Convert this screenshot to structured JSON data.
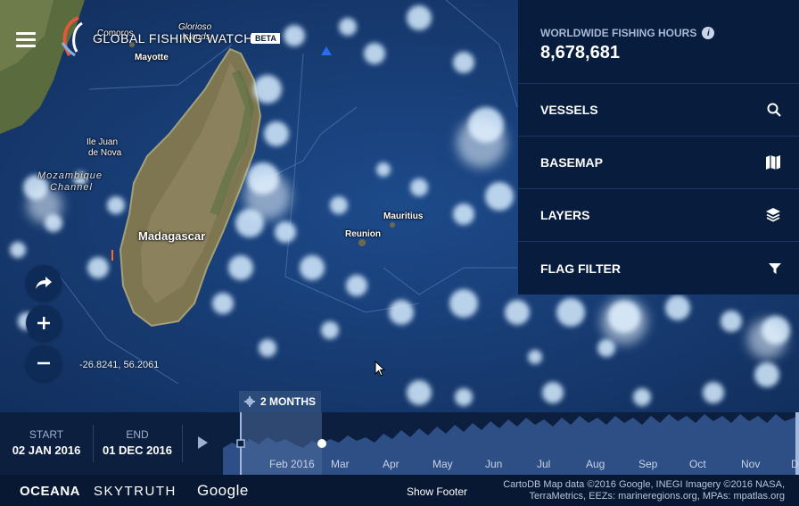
{
  "header": {
    "brand": "GLOBAL FISHING WATCH",
    "beta": "BETA"
  },
  "map": {
    "labels": {
      "comoros": "Comoros",
      "glorioso": "Glorioso",
      "islands": "Islands",
      "mayotte": "Mayotte",
      "ile_juan": "Ile Juan",
      "de_nova": "de Nova",
      "mozambique": "Mozambique",
      "channel": "Channel",
      "madagascar": "Madagascar",
      "mauritius": "Mauritius",
      "reunion": "Reunion"
    },
    "coordinates": "-26.8241, 56.2061"
  },
  "panel": {
    "stat_label": "WORLDWIDE FISHING HOURS",
    "stat_value": "8,678,681",
    "items": [
      {
        "label": "VESSELS",
        "icon": "search-icon"
      },
      {
        "label": "BASEMAP",
        "icon": "map-icon"
      },
      {
        "label": "LAYERS",
        "icon": "layers-icon"
      },
      {
        "label": "FLAG FILTER",
        "icon": "filter-icon"
      }
    ]
  },
  "timebar": {
    "start_label": "START",
    "start_date": "02 JAN 2016",
    "end_label": "END",
    "end_date": "01 DEC 2016",
    "range_label": "2 MONTHS",
    "months": [
      "Feb 2016",
      "Mar",
      "Apr",
      "May",
      "Jun",
      "Jul",
      "Aug",
      "Sep",
      "Oct",
      "Nov",
      "D"
    ]
  },
  "footer": {
    "logos": [
      "OCEANA",
      "SKYTRUTH",
      "Google"
    ],
    "show_footer": "Show Footer",
    "attribution_1": "CartoDB Map data ©2016 Google, INEGI Imagery ©2016 NASA,",
    "attribution_2": "TerraMetrics, EEZs: marineregions.org, MPAs: mpatlas.org"
  },
  "colors": {
    "panel_bg": "#081c3e",
    "ocean": "#1a3f78",
    "fishing_glow": "#cde8ff",
    "timeline_area": "#2d4f85"
  }
}
